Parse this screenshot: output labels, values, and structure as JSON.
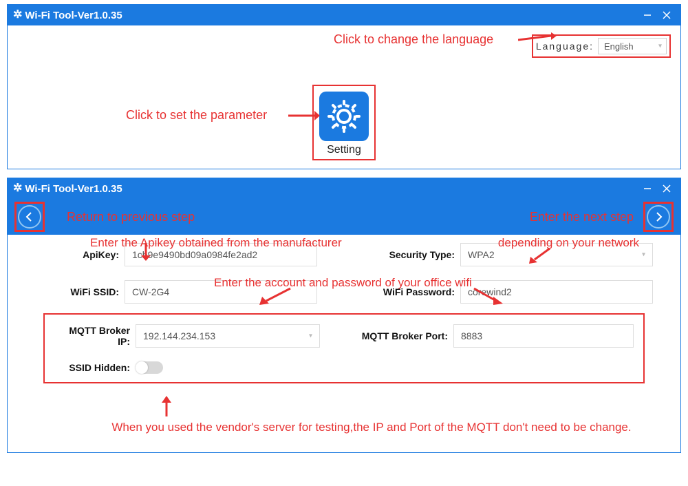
{
  "window1": {
    "title": "Wi-Fi Tool-Ver1.0.35",
    "language_label": "Language:",
    "language_value": "English",
    "setting_caption": "Setting"
  },
  "annot1": {
    "lang": "Click to change the language",
    "setting": "Click to set the parameter"
  },
  "window2": {
    "title": "Wi-Fi Tool-Ver1.0.35"
  },
  "annot2": {
    "back": "Return to previous step",
    "next": "Enter the next step",
    "apikey": "Enter the Apikey obtained from the manufacturer",
    "security": "depending on your network",
    "wifi": "Enter the account and password of your office wifi",
    "mqtt": "When you used the vendor's server for testing,the IP and Port of the MQTT don't need to be change."
  },
  "form": {
    "apikey_label": "ApiKey:",
    "apikey_value": "1cb9e9490bd09a0984fe2ad2",
    "security_label": "Security Type:",
    "security_value": "WPA2",
    "ssid_label": "WiFi SSID:",
    "ssid_value": "CW-2G4",
    "pwd_label": "WiFi Password:",
    "pwd_value": "corewind2",
    "broker_ip_label": "MQTT Broker IP:",
    "broker_ip_value": "192.144.234.153",
    "broker_port_label": "MQTT Broker Port:",
    "broker_port_value": "8883",
    "ssid_hidden_label": "SSID Hidden:"
  }
}
